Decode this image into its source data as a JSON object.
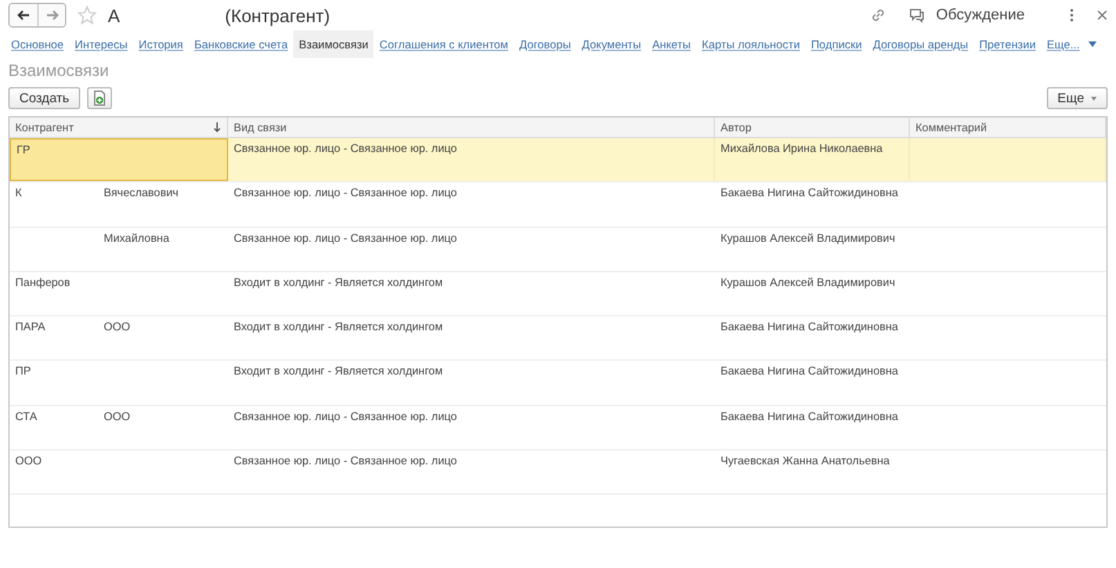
{
  "window": {
    "title": "А",
    "subtitle": "(Контрагент)",
    "favorite": false,
    "discussion": "Обсуждение"
  },
  "tabs": [
    {
      "label": "Основное",
      "selected": false
    },
    {
      "label": "Интересы",
      "selected": false
    },
    {
      "label": "История",
      "selected": false
    },
    {
      "label": "Банковские счета",
      "selected": false
    },
    {
      "label": "Взаимосвязи",
      "selected": true
    },
    {
      "label": "Соглашения с клиентом",
      "selected": false
    },
    {
      "label": "Договоры",
      "selected": false
    },
    {
      "label": "Документы",
      "selected": false
    },
    {
      "label": "Анкеты",
      "selected": false
    },
    {
      "label": "Карты лояльности",
      "selected": false
    },
    {
      "label": "Подписки",
      "selected": false
    },
    {
      "label": "Договоры аренды",
      "selected": false
    },
    {
      "label": "Претензии",
      "selected": false
    },
    {
      "label": "Еще...",
      "selected": false,
      "kind": "more"
    }
  ],
  "section_title": "Взаимосвязи",
  "toolbar": {
    "create": "Создать",
    "more": "Еще"
  },
  "table": {
    "columns": [
      {
        "label": "Контрагент",
        "sorted": true
      },
      {
        "label": "Вид связи",
        "sorted": false
      },
      {
        "label": "Автор",
        "sorted": false
      },
      {
        "label": "Комментарий",
        "sorted": false
      }
    ],
    "rows": [
      {
        "selected": true,
        "contragent": "ГР",
        "link_type": "Связанное юр. лицо - Связанное юр. лицо",
        "author": "Михайлова Ирина Николаевна"
      },
      {
        "selected": false,
        "contragent": "К",
        "contragent_2": "Вячеславович",
        "link_type": "Связанное юр. лицо - Связанное юр. лицо",
        "author": "Бакаева Нигина Сайтожидиновна"
      },
      {
        "selected": false,
        "contragent_2": "Михайловна",
        "link_type": "Связанное юр. лицо - Связанное юр. лицо",
        "author": "Курашов Алексей Владимирович"
      },
      {
        "selected": false,
        "contragent": "Панферов",
        "link_type": "Входит в холдинг - Является холдингом",
        "author": "Курашов Алексей Владимирович"
      },
      {
        "selected": false,
        "contragent": "ПАРА",
        "contragent_2": "ООО",
        "link_type": "Входит в холдинг - Является холдингом",
        "author": "Бакаева Нигина Сайтожидиновна"
      },
      {
        "selected": false,
        "contragent": "ПР",
        "link_type": "Входит в холдинг - Является холдингом",
        "author": "Бакаева Нигина Сайтожидиновна"
      },
      {
        "selected": false,
        "contragent": "СТА",
        "contragent_2": "ООО",
        "link_type": "Связанное юр. лицо - Связанное юр. лицо",
        "author": "Бакаева Нигина Сайтожидиновна"
      },
      {
        "selected": false,
        "contragent": "ООО",
        "link_type": "Связанное юр. лицо - Связанное юр. лицо",
        "author": "Чугаевская Жанна Анатольевна"
      }
    ]
  }
}
